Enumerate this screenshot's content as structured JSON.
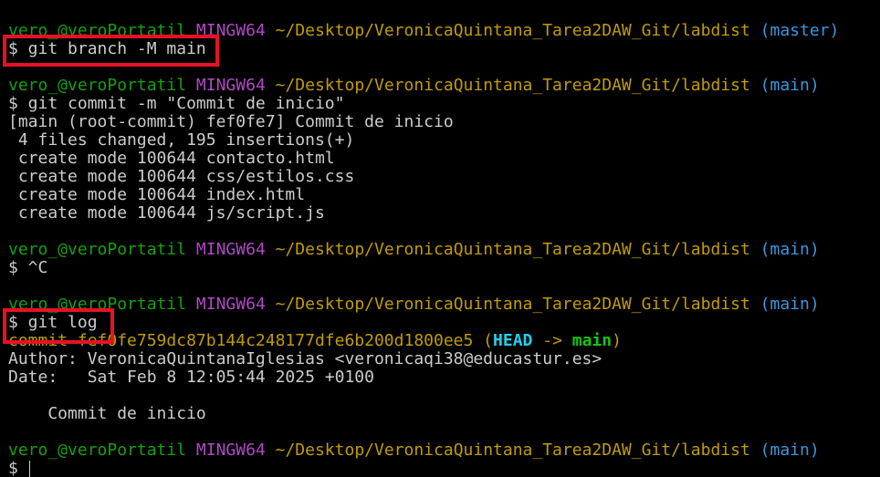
{
  "prompt": {
    "user": "vero_@veroPortatil",
    "system": "MINGW64",
    "path": "~/Desktop/VeronicaQuintana_Tarea2DAW_Git/labdist"
  },
  "blocks": [
    {
      "branch": "(master)",
      "command": "$ git branch -M main",
      "output": []
    },
    {
      "branch": "(main)",
      "command": "$ git commit -m \"Commit de inicio\"",
      "output": [
        "[main (root-commit) fef0fe7] Commit de inicio",
        " 4 files changed, 195 insertions(+)",
        " create mode 100644 contacto.html",
        " create mode 100644 css/estilos.css",
        " create mode 100644 index.html",
        " create mode 100644 js/script.js"
      ]
    },
    {
      "branch": "(main)",
      "command": "$ ^C",
      "output": []
    },
    {
      "branch": "(main)",
      "command": "$ git log",
      "output": []
    }
  ],
  "log": {
    "commit_label": "commit ",
    "commit_hash": "fef0fe759dc87b144c248177dfe6b200d1800ee5",
    "ref_open": " (",
    "head": "HEAD",
    "arrow": " -> ",
    "branch": "main",
    "ref_close": ")",
    "author": "Author: VeronicaQuintanaIglesias <veronicaqi38@educastur.es>",
    "date": "Date:   Sat Feb 8 12:05:44 2025 +0100",
    "message": "    Commit de inicio"
  },
  "final_block": {
    "branch": "(main)",
    "command": "$ "
  },
  "colors": {
    "background": "#000000",
    "prompt_user": "#13a10e",
    "prompt_system": "#b148c6",
    "prompt_path": "#c19c00",
    "prompt_branch": "#3a96dd",
    "highlight_box": "#e81123"
  }
}
